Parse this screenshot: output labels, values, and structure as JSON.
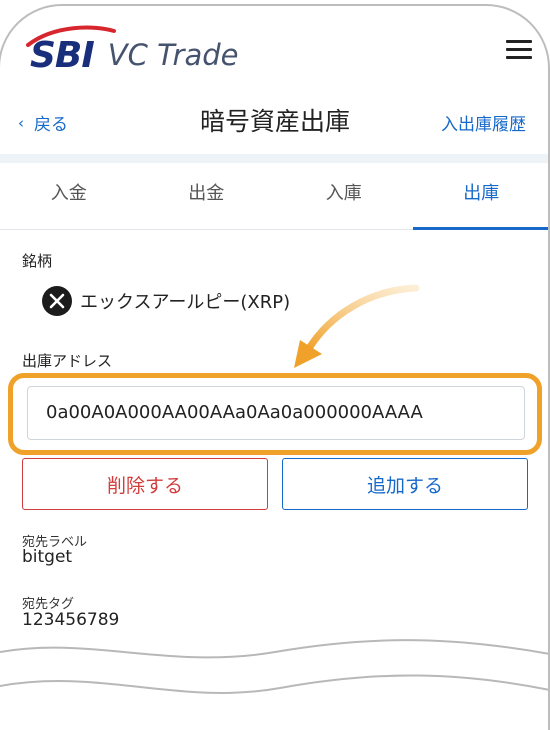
{
  "header": {
    "logo_sbi": "SBI",
    "logo_vc": "VC Trade",
    "menu_icon": "hamburger-menu-icon"
  },
  "topbar": {
    "back_label": "戻る",
    "title": "暗号資産出庫",
    "history_label": "入出庫履歴"
  },
  "tabs": [
    {
      "label": "入金",
      "active": false
    },
    {
      "label": "出金",
      "active": false
    },
    {
      "label": "入庫",
      "active": false
    },
    {
      "label": "出庫",
      "active": true
    }
  ],
  "form": {
    "asset_label": "銘柄",
    "asset_name": "エックスアールピー(XRP)",
    "asset_icon": "xrp-icon",
    "address_label": "出庫アドレス",
    "address_value": "0a00A0A000AA00AAa0Aa0a000000AAAA",
    "delete_label": "削除する",
    "add_label": "追加する",
    "dest_label_title": "宛先ラベル",
    "dest_label_value": "bitget",
    "dest_tag_title": "宛先タグ",
    "dest_tag_value": "123456789"
  },
  "colors": {
    "accent_blue": "#1769c9",
    "danger_red": "#d23c3c",
    "highlight_orange": "#f0a12a",
    "logo_navy": "#1a2f7c"
  }
}
